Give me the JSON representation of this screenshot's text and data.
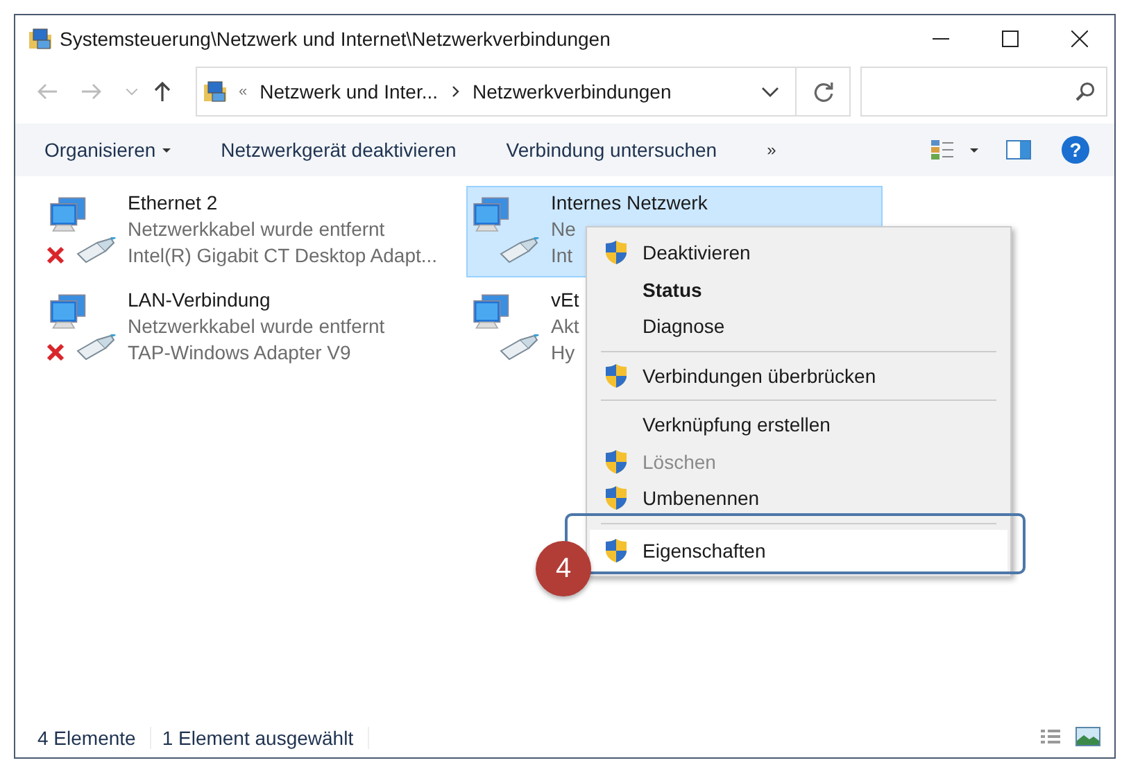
{
  "window": {
    "title": "Systemsteuerung\\Netzwerk und Internet\\Netzwerkverbindungen"
  },
  "address_bar": {
    "overflow": "«",
    "segments": [
      "Netzwerk und Inter...",
      "Netzwerkverbindungen"
    ]
  },
  "toolbar": {
    "items": [
      {
        "label": "Organisieren",
        "dropdown": true
      },
      {
        "label": "Netzwerkgerät deaktivieren",
        "dropdown": false
      },
      {
        "label": "Verbindung untersuchen",
        "dropdown": false
      }
    ],
    "more": "»",
    "help": "?"
  },
  "connections": [
    {
      "name": "Ethernet 2",
      "status": "Netzwerkkabel wurde entfernt",
      "adapter": "Intel(R) Gigabit CT Desktop Adapt...",
      "disconnected": true,
      "selected": false
    },
    {
      "name": "Internes Netzwerk",
      "status": "Ne",
      "adapter": "Int",
      "disconnected": false,
      "selected": true
    },
    {
      "name": "LAN-Verbindung",
      "status": "Netzwerkkabel wurde entfernt",
      "adapter": "TAP-Windows Adapter V9",
      "disconnected": true,
      "selected": false
    },
    {
      "name": "vEt",
      "status": "Akt",
      "adapter": "Hy",
      "disconnected": false,
      "selected": false
    }
  ],
  "context_menu": [
    {
      "kind": "item",
      "label": "Deaktivieren",
      "shield": true,
      "bold": false,
      "disabled": false,
      "highlighted": false
    },
    {
      "kind": "item",
      "label": "Status",
      "shield": false,
      "bold": true,
      "disabled": false,
      "highlighted": false
    },
    {
      "kind": "item",
      "label": "Diagnose",
      "shield": false,
      "bold": false,
      "disabled": false,
      "highlighted": false
    },
    {
      "kind": "separator"
    },
    {
      "kind": "item",
      "label": "Verbindungen überbrücken",
      "shield": true,
      "bold": false,
      "disabled": false,
      "highlighted": false
    },
    {
      "kind": "separator"
    },
    {
      "kind": "item",
      "label": "Verknüpfung erstellen",
      "shield": false,
      "bold": false,
      "disabled": false,
      "highlighted": false
    },
    {
      "kind": "item",
      "label": "Löschen",
      "shield": true,
      "bold": false,
      "disabled": true,
      "highlighted": false
    },
    {
      "kind": "item",
      "label": "Umbenennen",
      "shield": true,
      "bold": false,
      "disabled": false,
      "highlighted": false
    },
    {
      "kind": "separator"
    },
    {
      "kind": "item",
      "label": "Eigenschaften",
      "shield": true,
      "bold": false,
      "disabled": false,
      "highlighted": true
    }
  ],
  "step_badge": "4",
  "status_bar": {
    "count": "4 Elemente",
    "selection": "1 Element ausgewählt"
  }
}
